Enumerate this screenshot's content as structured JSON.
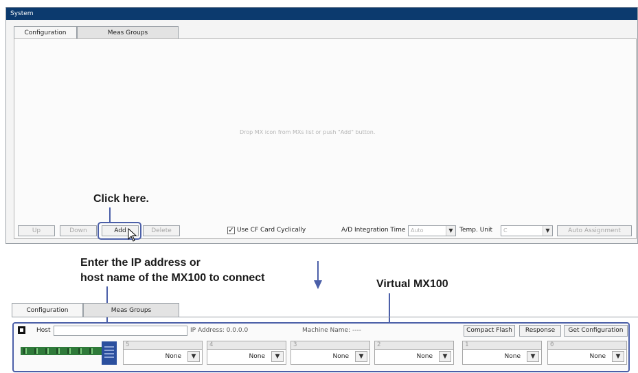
{
  "window": {
    "title": "System"
  },
  "tabs": [
    "Configuration",
    "Meas Groups"
  ],
  "panel": {
    "drop_message": "Drop MX icon from MXs list or push \"Add\" button."
  },
  "toolbar": {
    "up": "Up",
    "down": "Down",
    "add": "Add",
    "delete": "Delete",
    "use_cf_card": "Use CF Card Cyclically",
    "ad_label": "A/D Integration Time",
    "ad_value": "Auto",
    "temp_label": "Temp. Unit",
    "temp_value": "C",
    "auto_assignment": "Auto Assignment"
  },
  "callouts": {
    "click_here": "Click here.",
    "enter_ip_line1": "Enter the IP address or",
    "enter_ip_line2": "host name of the MX100 to connect",
    "virtual": "Virtual MX100"
  },
  "mx": {
    "host_label": "Host",
    "host_value": "",
    "ip_text": "IP Address: 0.0.0.0",
    "machine_text": "Machine Name:   ----",
    "compact_flash": "Compact Flash",
    "response": "Response",
    "get_config": "Get Configuration",
    "slots": [
      {
        "num": "5",
        "value": "None"
      },
      {
        "num": "4",
        "value": "None"
      },
      {
        "num": "3",
        "value": "None"
      },
      {
        "num": "2",
        "value": "None"
      },
      {
        "num": "1",
        "value": "None"
      },
      {
        "num": "0",
        "value": "None"
      }
    ]
  },
  "colors": {
    "titlebar": "#0c3a6e",
    "frame": "#4b5fa8"
  }
}
